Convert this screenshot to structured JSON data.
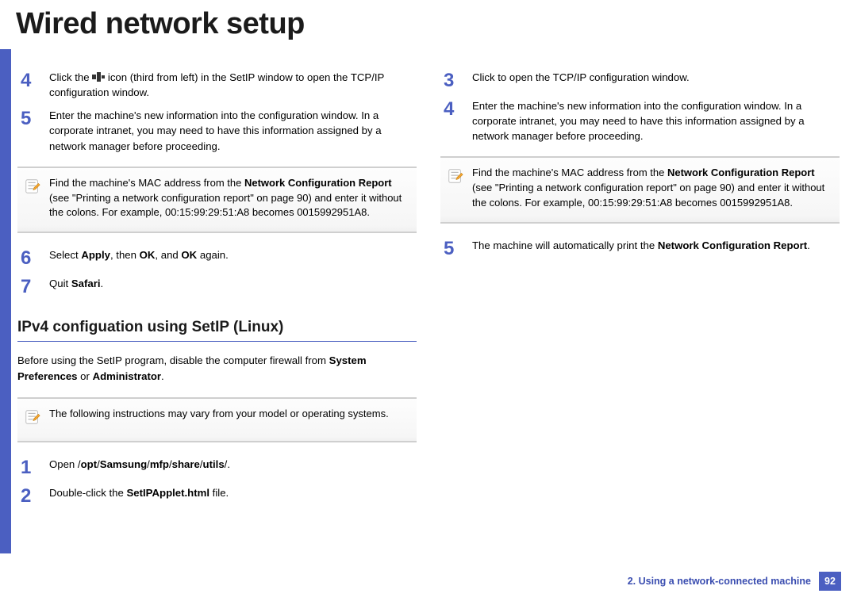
{
  "title": "Wired network setup",
  "left": {
    "step4": {
      "pre": "Click the ",
      "post": " icon (third from left) in the SetIP window to open the TCP/IP configuration window."
    },
    "step5": "Enter the machine's new information into the configuration window. In a corporate intranet, you may need to have this information assigned by a network manager before proceeding.",
    "note1_pre": "Find the machine's MAC address from the ",
    "note1_bold": "Network Configuration Report",
    "note1_post": " (see \"Printing a network configuration report\" on page 90) and enter it without the colons. For example, 00:15:99:29:51:A8 becomes 0015992951A8.",
    "step6_pre": "Select ",
    "step6_b1": "Apply",
    "step6_mid1": ", then ",
    "step6_b2": "OK",
    "step6_mid2": ", and ",
    "step6_b3": "OK",
    "step6_post": " again.",
    "step7_pre": "Quit ",
    "step7_b": "Safari",
    "step7_post": ".",
    "subhead": "IPv4 configuation using SetIP (Linux)",
    "para_pre": "Before using the SetIP program, disable the computer firewall from ",
    "para_b1": "System Preferences",
    "para_mid": " or ",
    "para_b2": "Administrator",
    "para_post": ".",
    "note2": "The following instructions may vary from your model or operating systems.",
    "step1_pre": "Open /",
    "step1_b1": "opt",
    "step1_s1": "/",
    "step1_b2": "Samsung",
    "step1_s2": "/",
    "step1_b3": "mfp",
    "step1_s3": "/",
    "step1_b4": "share",
    "step1_s4": "/",
    "step1_b5": "utils",
    "step1_s5": "/.",
    "step2_pre": "Double-click the ",
    "step2_b": "SetIPApplet.html",
    "step2_post": " file."
  },
  "right": {
    "step3": "Click to open the TCP/IP configuration window.",
    "step4": "Enter the machine's new information into the configuration window. In a corporate intranet, you may need to have this information assigned by a network manager before proceeding.",
    "note_pre": "Find the machine's MAC address from the ",
    "note_bold": "Network Configuration Report",
    "note_post": " (see \"Printing a network configuration report\" on page 90) and enter it without the colons. For example, 00:15:99:29:51:A8 becomes 0015992951A8.",
    "step5_pre": "The machine will automatically print the ",
    "step5_b": "Network Configuration Report",
    "step5_post": "."
  },
  "nums": {
    "n1": "1",
    "n2": "2",
    "n3": "3",
    "n4": "4",
    "n5": "5",
    "n6": "6",
    "n7": "7"
  },
  "footer": {
    "chapter": "2.  Using a network-connected machine",
    "page": "92"
  }
}
